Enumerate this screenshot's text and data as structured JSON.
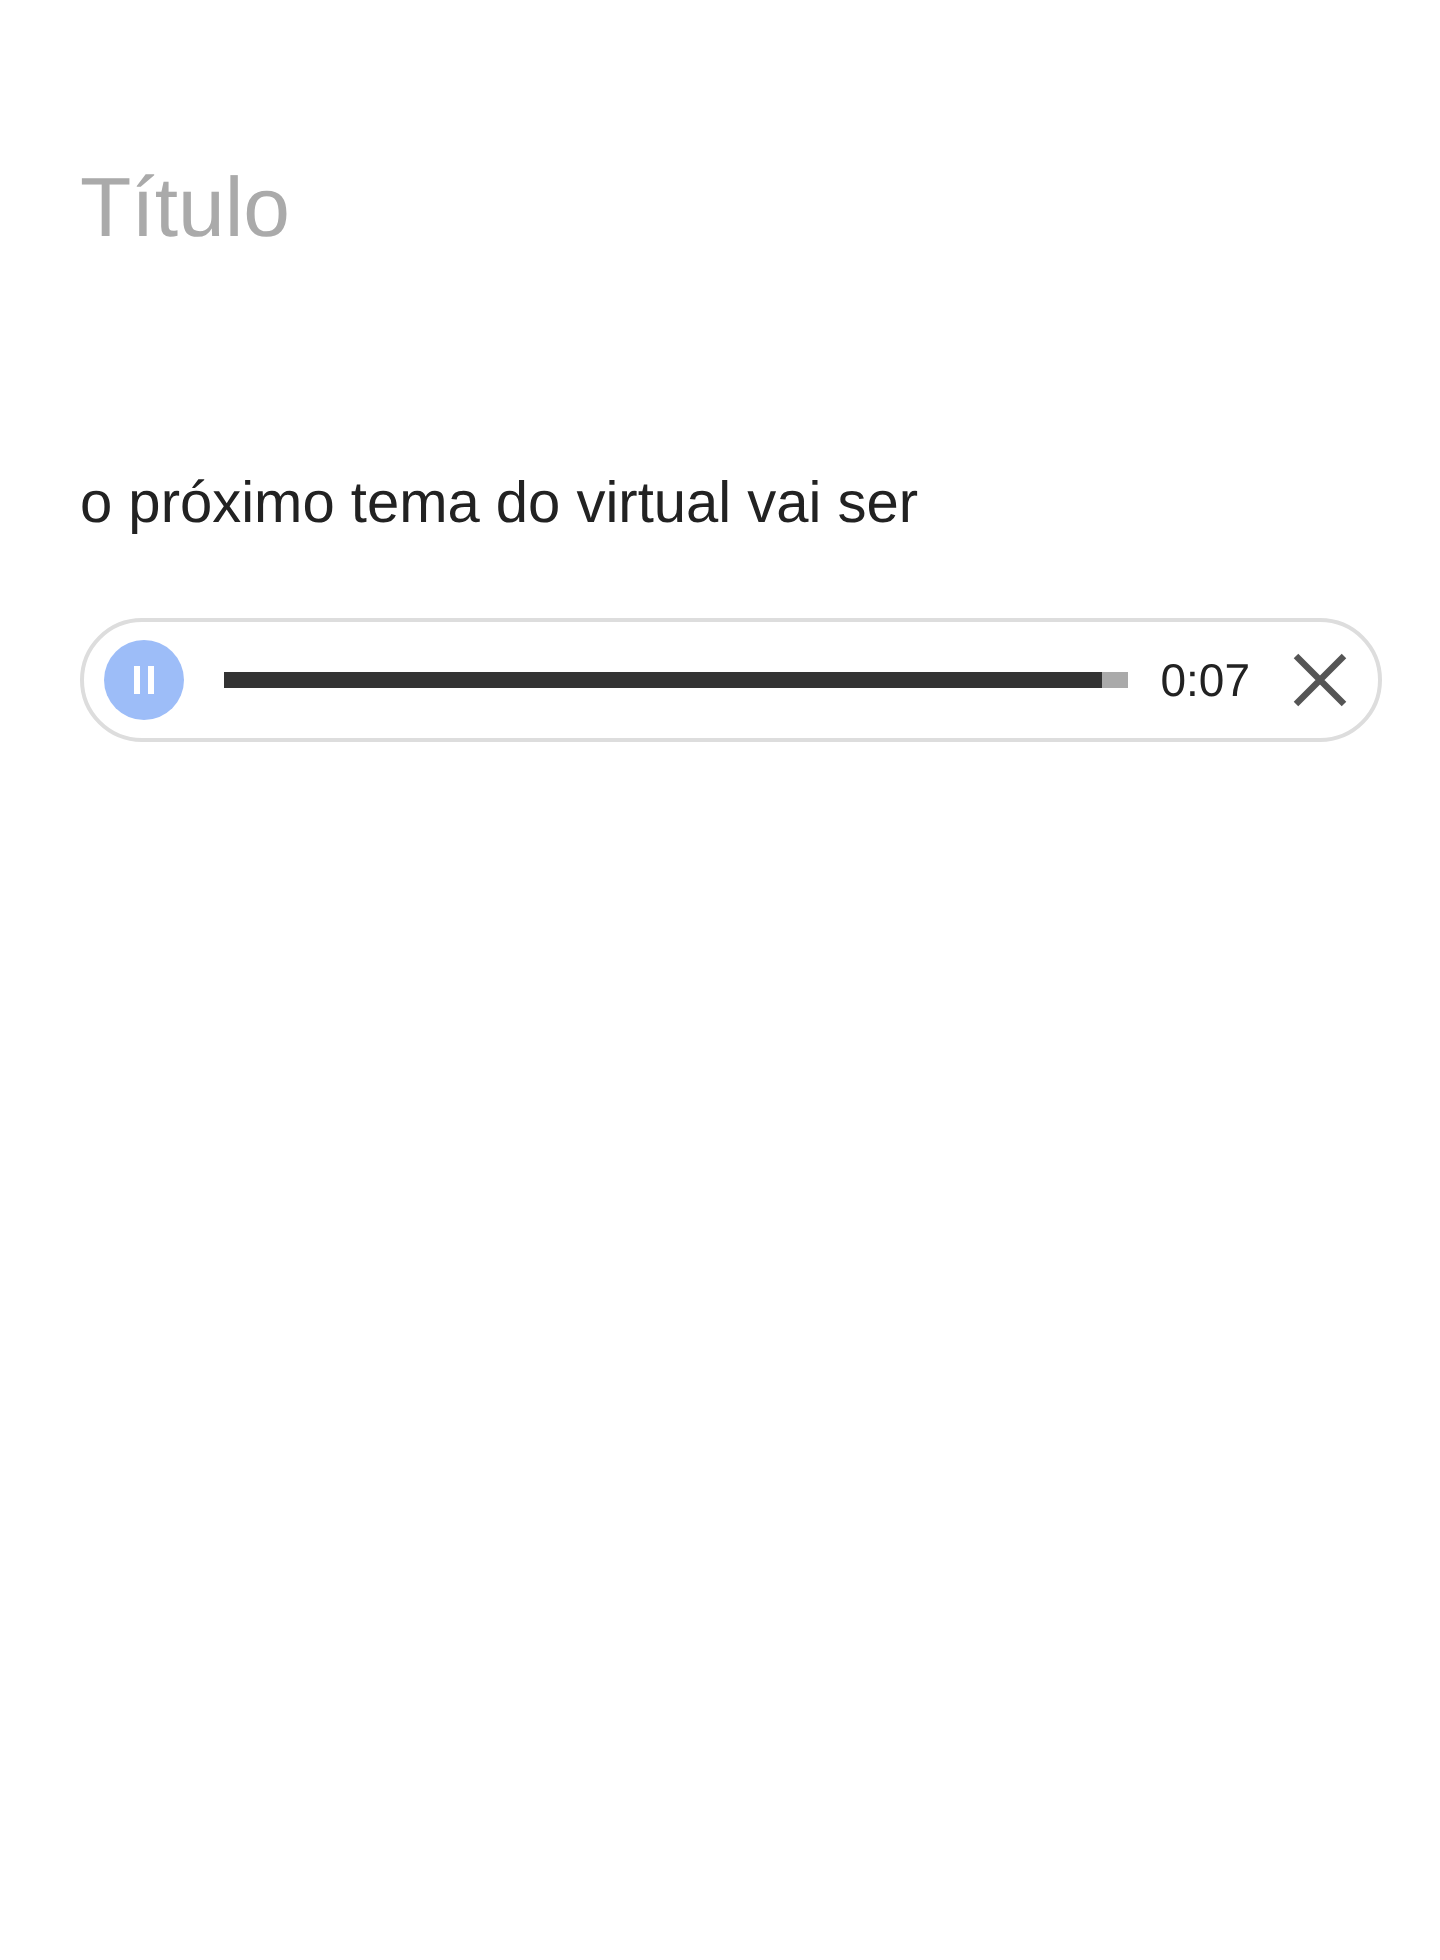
{
  "title": {
    "placeholder": "Título"
  },
  "body": {
    "text": "o próximo tema do virtual vai ser"
  },
  "audio": {
    "playing": true,
    "level": 0.97,
    "time": "0:07"
  }
}
